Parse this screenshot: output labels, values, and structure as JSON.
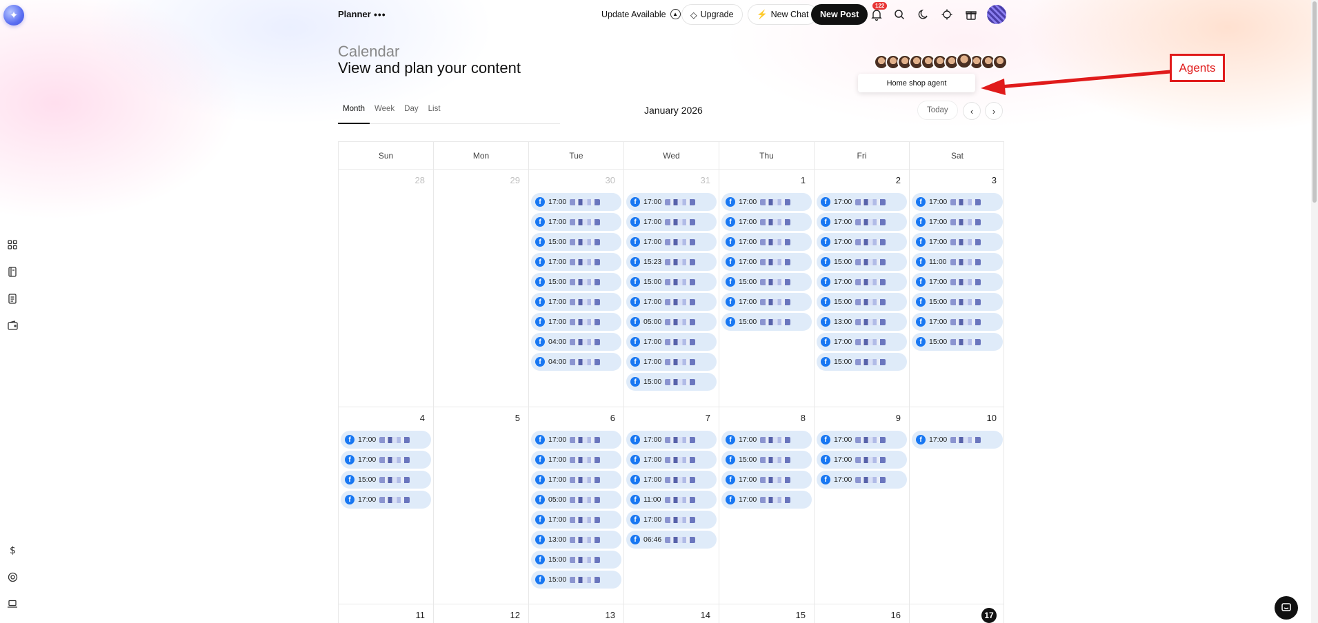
{
  "app": {
    "title": "Planner",
    "more_icon": "ellipsis-icon",
    "update_label": "Update Available",
    "upgrade_label": "Upgrade",
    "new_chat_label": "New Chat",
    "new_post_label": "New Post",
    "notification_count": "122"
  },
  "header": {
    "label": "Calendar",
    "subtitle": "View and plan your content"
  },
  "agents": {
    "tooltip": "Home shop agent",
    "annotation": "Agents"
  },
  "views": {
    "tabs": [
      {
        "label": "Month",
        "active": true
      },
      {
        "label": "Week",
        "active": false
      },
      {
        "label": "Day",
        "active": false
      },
      {
        "label": "List",
        "active": false
      }
    ],
    "month_title": "January 2026",
    "today_label": "Today"
  },
  "weekdays": [
    "Sun",
    "Mon",
    "Tue",
    "Wed",
    "Thu",
    "Fri",
    "Sat"
  ],
  "weeks": [
    [
      {
        "day": "28",
        "muted": true,
        "events": []
      },
      {
        "day": "29",
        "muted": true,
        "events": []
      },
      {
        "day": "30",
        "muted": true,
        "events": [
          "17:00",
          "17:00",
          "15:00",
          "17:00",
          "15:00",
          "17:00",
          "17:00",
          "04:00",
          "04:00"
        ]
      },
      {
        "day": "31",
        "muted": true,
        "events": [
          "17:00",
          "17:00",
          "17:00",
          "15:23",
          "15:00",
          "17:00",
          "05:00",
          "17:00",
          "17:00",
          "15:00"
        ]
      },
      {
        "day": "1",
        "muted": false,
        "events": [
          "17:00",
          "17:00",
          "17:00",
          "17:00",
          "15:00",
          "17:00",
          "15:00"
        ]
      },
      {
        "day": "2",
        "muted": false,
        "events": [
          "17:00",
          "17:00",
          "17:00",
          "15:00",
          "17:00",
          "15:00",
          "13:00",
          "17:00",
          "15:00"
        ]
      },
      {
        "day": "3",
        "muted": false,
        "events": [
          "17:00",
          "17:00",
          "17:00",
          "11:00",
          "17:00",
          "15:00",
          "17:00",
          "15:00"
        ]
      }
    ],
    [
      {
        "day": "4",
        "muted": false,
        "events": [
          "17:00",
          "17:00",
          "15:00",
          "17:00"
        ]
      },
      {
        "day": "5",
        "muted": false,
        "events": []
      },
      {
        "day": "6",
        "muted": false,
        "events": [
          "17:00",
          "17:00",
          "17:00",
          "05:00",
          "17:00",
          "13:00",
          "15:00",
          "15:00"
        ]
      },
      {
        "day": "7",
        "muted": false,
        "events": [
          "17:00",
          "17:00",
          "17:00",
          "11:00",
          "17:00",
          "06:46"
        ]
      },
      {
        "day": "8",
        "muted": false,
        "events": [
          "17:00",
          "15:00",
          "17:00",
          "17:00"
        ]
      },
      {
        "day": "9",
        "muted": false,
        "events": [
          "17:00",
          "17:00",
          "17:00"
        ]
      },
      {
        "day": "10",
        "muted": false,
        "events": [
          "17:00"
        ]
      }
    ],
    [
      {
        "day": "11",
        "muted": false,
        "events": []
      },
      {
        "day": "12",
        "muted": false,
        "events": []
      },
      {
        "day": "13",
        "muted": false,
        "events": []
      },
      {
        "day": "14",
        "muted": false,
        "events": []
      },
      {
        "day": "15",
        "muted": false,
        "events": []
      },
      {
        "day": "16",
        "muted": false,
        "events": []
      },
      {
        "day": "17",
        "muted": false,
        "today": true,
        "events": []
      }
    ]
  ],
  "colors": {
    "accent": "#111111",
    "event_bg": "#dfebf9",
    "facebook": "#1877f2",
    "annotation": "#e01b1b",
    "notification_badge": "#e83535"
  },
  "icons": {
    "event_platform": "facebook-icon"
  }
}
